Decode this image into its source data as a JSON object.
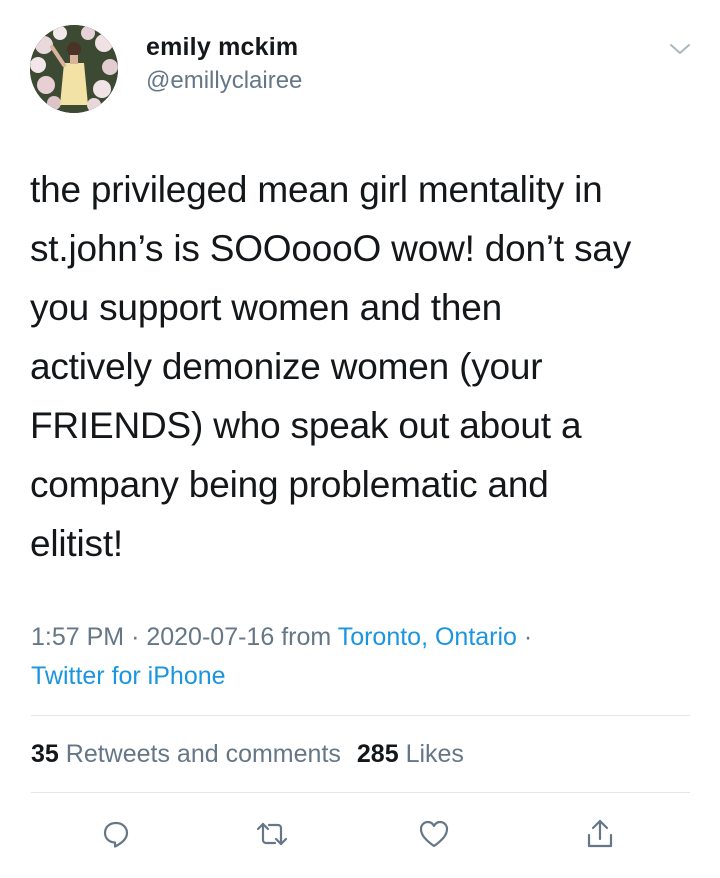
{
  "user": {
    "display_name": "emily mckim",
    "handle": "@emillyclairee",
    "avatar_icon": "profile-photo"
  },
  "tweet": {
    "text": "the privileged mean girl mentality in\nst.john’s is SOOoooO wow! don’t say\nyou support women and then\nactively demonize women (your\nFRIENDS) who speak out about a\ncompany being problematic and\nelitist!",
    "time": "1:57 PM",
    "separator": "·",
    "date": "2020-07-16",
    "from_label": "from",
    "location": "Toronto, Ontario",
    "source": "Twitter for iPhone"
  },
  "stats": {
    "retweets_count": "35",
    "retweets_label": "Retweets and comments",
    "likes_count": "285",
    "likes_label": "Likes"
  },
  "actions": {
    "reply_icon": "reply-icon",
    "retweet_icon": "retweet-icon",
    "like_icon": "heart-icon",
    "share_icon": "share-icon"
  },
  "colors": {
    "text": "#14171a",
    "secondary": "#657786",
    "link": "#1b95e0",
    "divider": "#e1e8ed"
  }
}
